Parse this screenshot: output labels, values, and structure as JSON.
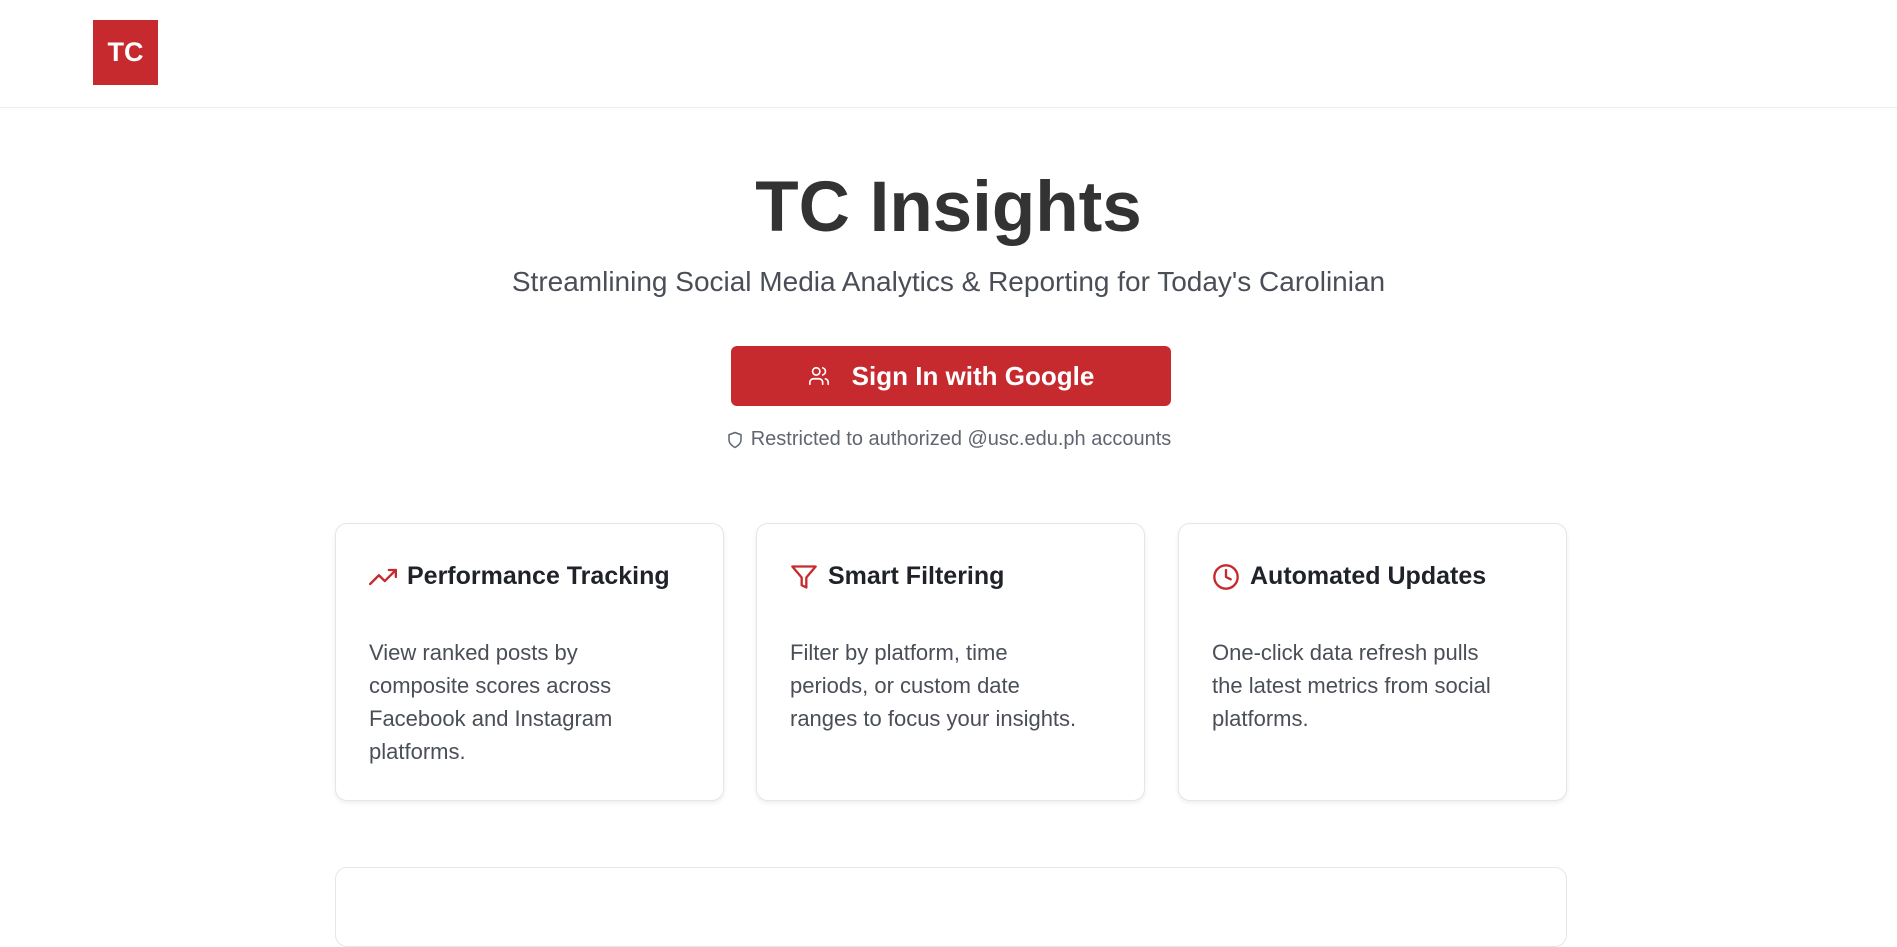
{
  "header": {
    "logo_text": "TC"
  },
  "hero": {
    "title": "TC Insights",
    "subtitle": "Streamlining Social Media Analytics & Reporting for Today's Carolinian"
  },
  "signin": {
    "label": "Sign In with Google",
    "icon": "users-icon"
  },
  "restriction": {
    "text": "Restricted to authorized @usc.edu.ph accounts",
    "icon": "shield-icon"
  },
  "features": [
    {
      "icon": "trending-up-icon",
      "title": "Performance Tracking",
      "description": "View ranked posts by composite scores across Facebook and Instagram platforms."
    },
    {
      "icon": "filter-icon",
      "title": "Smart Filtering",
      "description": "Filter by platform, time periods, or custom date ranges to focus your insights."
    },
    {
      "icon": "clock-icon",
      "title": "Automated Updates",
      "description": "One-click data refresh pulls the latest metrics from social platforms."
    }
  ],
  "colors": {
    "brand": "#c62a2f",
    "heading": "#333333",
    "body_text": "#4a4f57"
  }
}
